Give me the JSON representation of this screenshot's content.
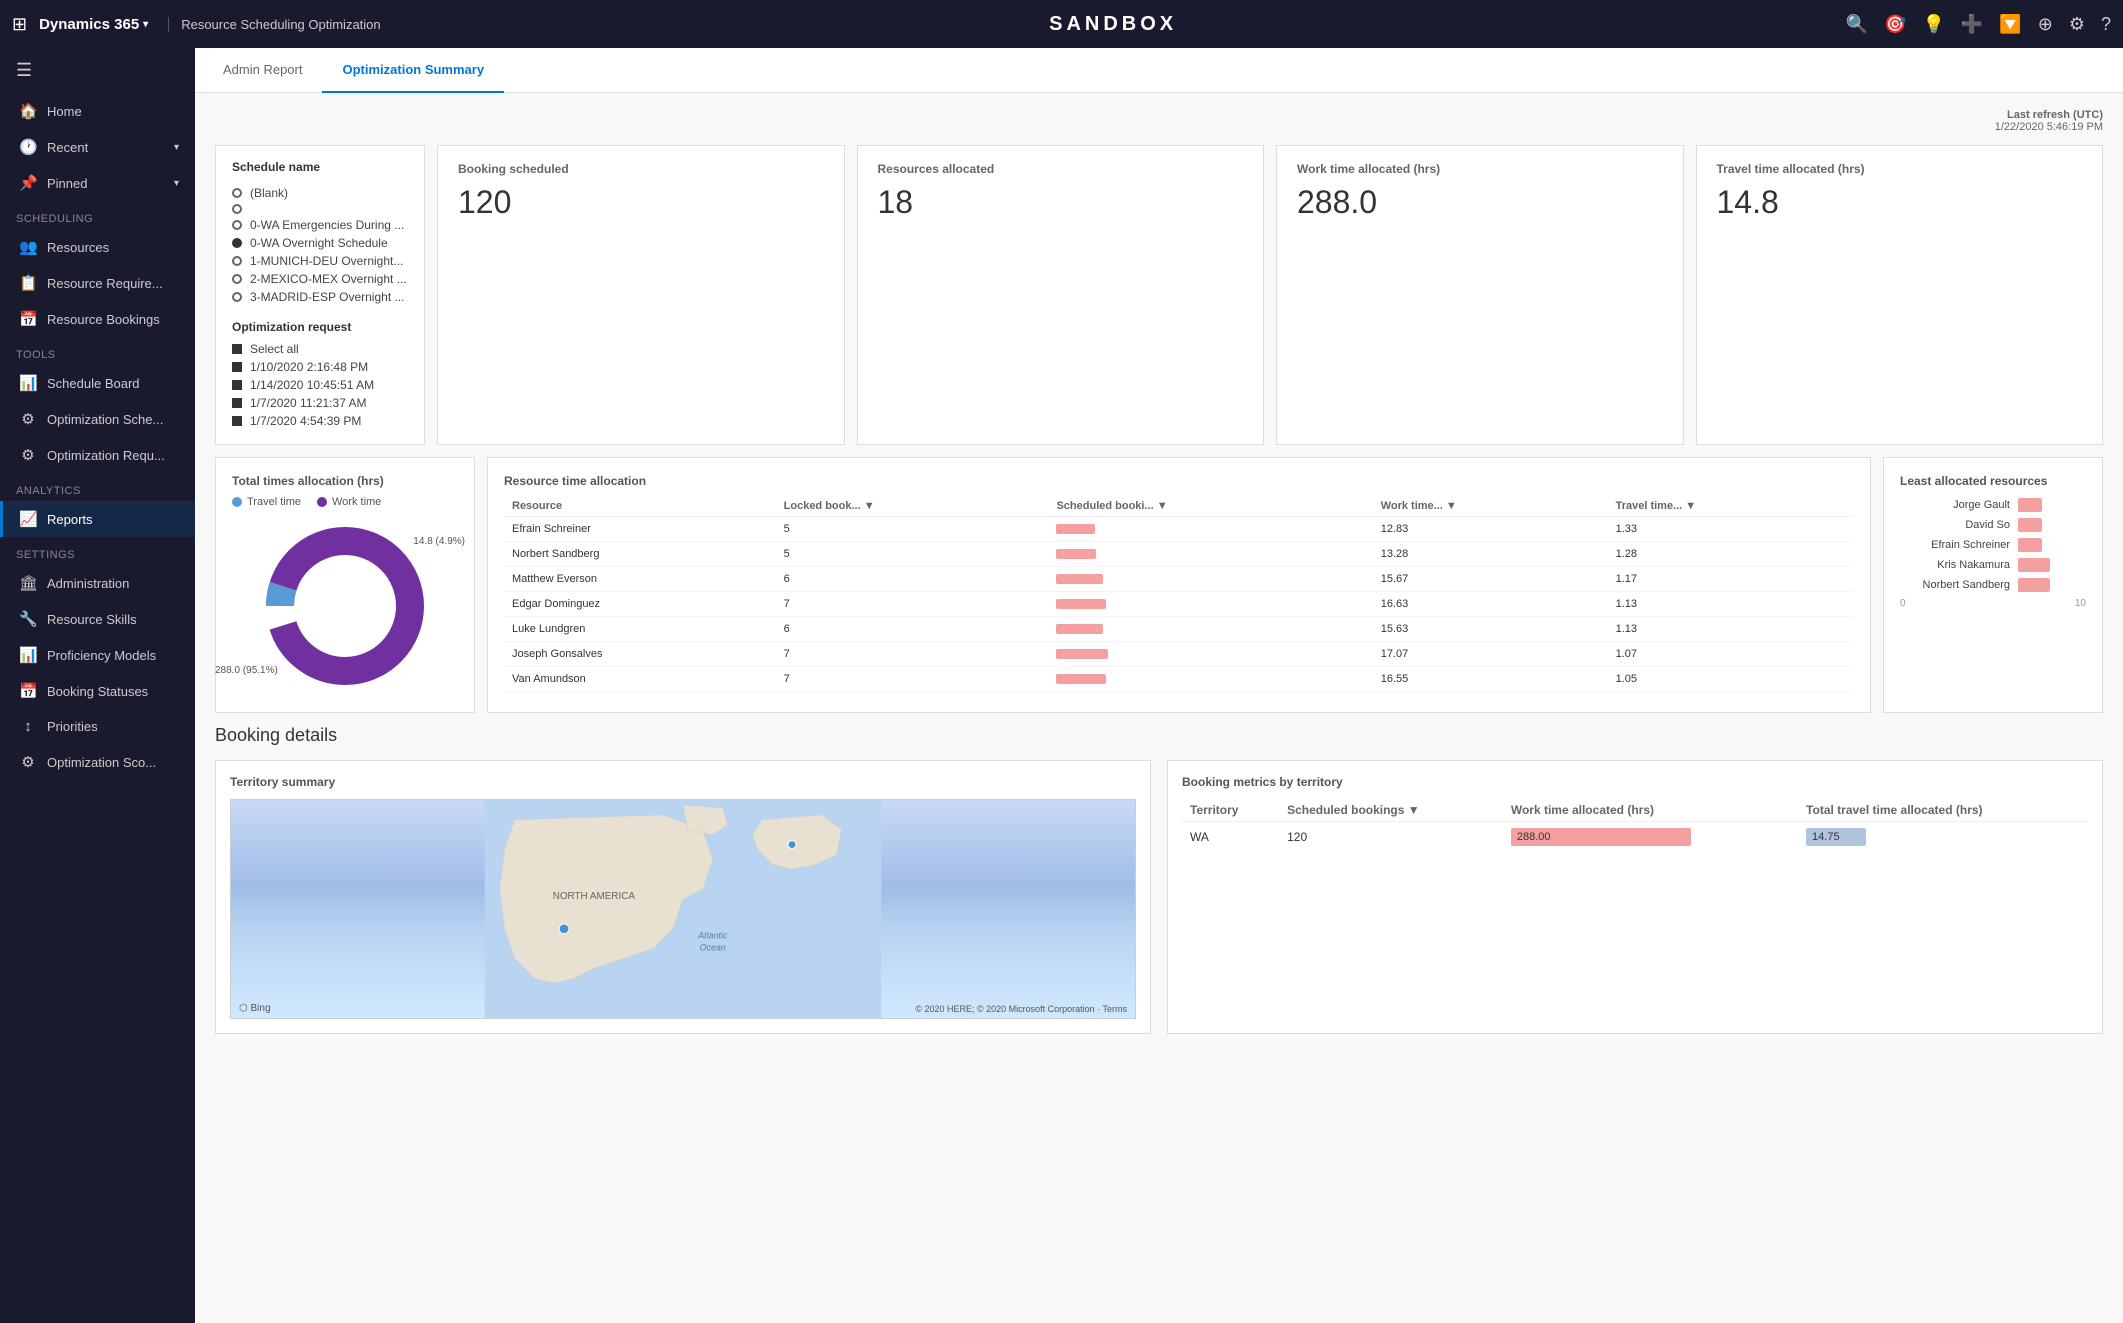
{
  "topbar": {
    "waffle_icon": "⊞",
    "brand": "Dynamics 365",
    "brand_chevron": "▾",
    "page_title": "Resource Scheduling Optimization",
    "sandbox_label": "SANDBOX",
    "icons": [
      "🔍",
      "⚙",
      "🔔",
      "➕",
      "🔽",
      "⚙",
      "⚙",
      "?"
    ]
  },
  "tabs": [
    {
      "label": "Admin Report",
      "active": false
    },
    {
      "label": "Optimization Summary",
      "active": true
    }
  ],
  "sidebar": {
    "sections": [
      {
        "label": "",
        "items": [
          {
            "icon": "🏠",
            "label": "Home",
            "active": false,
            "chevron": false
          },
          {
            "icon": "🕐",
            "label": "Recent",
            "active": false,
            "chevron": true
          },
          {
            "icon": "📌",
            "label": "Pinned",
            "active": false,
            "chevron": true
          }
        ]
      },
      {
        "label": "Scheduling",
        "items": [
          {
            "icon": "👥",
            "label": "Resources",
            "active": false,
            "chevron": false
          },
          {
            "icon": "📋",
            "label": "Resource Require...",
            "active": false,
            "chevron": false
          },
          {
            "icon": "📅",
            "label": "Resource Bookings",
            "active": false,
            "chevron": false
          }
        ]
      },
      {
        "label": "Tools",
        "items": [
          {
            "icon": "📊",
            "label": "Schedule Board",
            "active": false,
            "chevron": false
          },
          {
            "icon": "⚙",
            "label": "Optimization Sche...",
            "active": false,
            "chevron": false
          },
          {
            "icon": "⚙",
            "label": "Optimization Requ...",
            "active": false,
            "chevron": false
          }
        ]
      },
      {
        "label": "Analytics",
        "items": [
          {
            "icon": "📈",
            "label": "Reports",
            "active": true,
            "chevron": false
          }
        ]
      },
      {
        "label": "Settings",
        "items": [
          {
            "icon": "🏛",
            "label": "Administration",
            "active": false,
            "chevron": false
          },
          {
            "icon": "🔧",
            "label": "Resource Skills",
            "active": false,
            "chevron": false
          },
          {
            "icon": "📊",
            "label": "Proficiency Models",
            "active": false,
            "chevron": false
          },
          {
            "icon": "📅",
            "label": "Booking Statuses",
            "active": false,
            "chevron": false
          },
          {
            "icon": "↕",
            "label": "Priorities",
            "active": false,
            "chevron": false
          },
          {
            "icon": "⚙",
            "label": "Optimization Sco...",
            "active": false,
            "chevron": false
          }
        ]
      }
    ]
  },
  "last_refresh": {
    "label": "Last refresh (UTC)",
    "value": "1/22/2020 5:46:19 PM"
  },
  "schedule_panel": {
    "title": "Schedule name",
    "items": [
      {
        "label": "(Blank)",
        "filled": false
      },
      {
        "label": "",
        "filled": false
      },
      {
        "label": "0-WA Emergencies During ...",
        "filled": false
      },
      {
        "label": "0-WA Overnight Schedule",
        "filled": true
      },
      {
        "label": "1-MUNICH-DEU Overnight...",
        "filled": false
      },
      {
        "label": "2-MEXICO-MEX Overnight ...",
        "filled": false
      },
      {
        "label": "3-MADRID-ESP Overnight ...",
        "filled": false
      }
    ],
    "opt_title": "Optimization request",
    "opt_items": [
      {
        "label": "Select all"
      },
      {
        "label": "1/10/2020 2:16:48 PM"
      },
      {
        "label": "1/14/2020 10:45:51 AM"
      },
      {
        "label": "1/7/2020 11:21:37 AM"
      },
      {
        "label": "1/7/2020 4:54:39 PM"
      }
    ]
  },
  "stats": [
    {
      "label": "Booking scheduled",
      "value": "120"
    },
    {
      "label": "Resources allocated",
      "value": "18"
    },
    {
      "label": "Work time allocated (hrs)",
      "value": "288.0"
    },
    {
      "label": "Travel time allocated (hrs)",
      "value": "14.8"
    }
  ],
  "donut_chart": {
    "title": "Total times allocation (hrs)",
    "travel_label": "Travel time",
    "work_label": "Work time",
    "travel_value": 14.8,
    "work_value": 288.0,
    "travel_pct": "4.9%",
    "work_pct": "95.1%",
    "travel_annotation": "14.8 (4.9%)",
    "work_annotation": "288.0 (95.1%)"
  },
  "resource_table": {
    "title": "Resource time allocation",
    "columns": [
      "Resource",
      "Locked book...",
      "Scheduled booki...",
      "Work time...",
      "Travel time..."
    ],
    "rows": [
      {
        "name": "Efrain Schreiner",
        "locked": 5,
        "scheduled": null,
        "work": 12.83,
        "travel": 1.33
      },
      {
        "name": "Norbert Sandberg",
        "locked": 5,
        "scheduled": null,
        "work": 13.28,
        "travel": 1.28
      },
      {
        "name": "Matthew Everson",
        "locked": 6,
        "scheduled": null,
        "work": 15.67,
        "travel": 1.17
      },
      {
        "name": "Edgar Dominguez",
        "locked": 7,
        "scheduled": null,
        "work": 16.63,
        "travel": 1.13
      },
      {
        "name": "Luke Lundgren",
        "locked": 6,
        "scheduled": null,
        "work": 15.63,
        "travel": 1.13
      },
      {
        "name": "Joseph Gonsalves",
        "locked": 7,
        "scheduled": null,
        "work": 17.07,
        "travel": 1.07
      },
      {
        "name": "Van Amundson",
        "locked": 7,
        "scheduled": null,
        "work": 16.55,
        "travel": 1.05
      }
    ]
  },
  "least_allocated": {
    "title": "Least allocated resources",
    "items": [
      {
        "name": "Jorge Gault",
        "value": 3
      },
      {
        "name": "David So",
        "value": 3
      },
      {
        "name": "Efrain Schreiner",
        "value": 3
      },
      {
        "name": "Kris Nakamura",
        "value": 4
      },
      {
        "name": "Norbert Sandberg",
        "value": 4
      }
    ],
    "axis": [
      "0",
      "10"
    ]
  },
  "booking_details": {
    "title": "Booking details",
    "territory_title": "Territory summary",
    "metrics_title": "Booking metrics by territory",
    "metrics_columns": [
      "Territory",
      "Scheduled bookings",
      "Work time allocated (hrs)",
      "Total travel time allocated (hrs)"
    ],
    "metrics_rows": [
      {
        "territory": "WA",
        "scheduled": 120,
        "work_bar": 288.0,
        "travel_bar": 14.75
      }
    ],
    "map_label": "NORTH AMERICA",
    "bing_label": "⬡ Bing",
    "copyright": "© 2020 HERE; © 2020 Microsoft Corporation · Terms"
  }
}
